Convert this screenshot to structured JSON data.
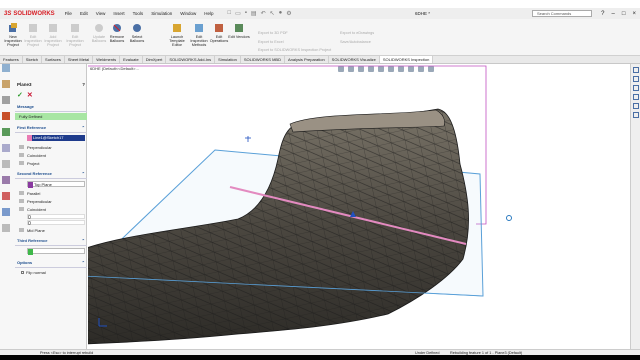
{
  "app": {
    "brand": "SOLIDWORKS",
    "doc_title": "6DHE *",
    "search_placeholder": "Search Commands"
  },
  "menu": [
    "File",
    "Edit",
    "View",
    "Insert",
    "Tools",
    "Simulation",
    "Window",
    "Help"
  ],
  "commands": [
    {
      "label": "New Inspection Project",
      "enabled": true
    },
    {
      "label": "Edit Inspection Project",
      "enabled": false
    },
    {
      "label": "Add Inspection Project",
      "enabled": false
    },
    {
      "label": "Edit Inspection Project",
      "enabled": false
    },
    {
      "label": "Update Balloons",
      "enabled": false
    },
    {
      "label": "Remove Balloons",
      "enabled": true
    },
    {
      "label": "Select Balloons",
      "enabled": true
    },
    {
      "label": "Launch Template Editor",
      "enabled": true
    },
    {
      "label": "Edit Inspection Methods",
      "enabled": true
    },
    {
      "label": "Edit Operations",
      "enabled": true
    },
    {
      "label": "Edit Vendors",
      "enabled": true
    }
  ],
  "small_commands": [
    "Export to 3D PDF",
    "Export to Excel",
    "Export to SOLIDWORKS Inspection Project",
    "Export to eDrawings",
    "Save/Autobalance"
  ],
  "tabs": [
    "Features",
    "Sketch",
    "Surfaces",
    "Sheet Metal",
    "Weldments",
    "Evaluate",
    "DimXpert",
    "SOLIDWORKS Add-Ins",
    "Simulation",
    "SOLIDWORKS MBD",
    "Analysis Preparation",
    "SOLIDWORKS Visualize",
    "SOLIDWORKS Inspection"
  ],
  "active_tab": "SOLIDWORKS Inspection",
  "feature_tree_path": "6DHE (Default<<Default>...",
  "property_manager": {
    "title": "Plane3",
    "message_label": "Message",
    "message_text": "Fully Defined",
    "first_reference": {
      "header": "First Reference",
      "value": "Line1@Sketch17",
      "options": [
        "Perpendicular",
        "Coincident",
        "Project"
      ]
    },
    "second_reference": {
      "header": "Second Reference",
      "value": "Top Plane",
      "options": [
        "Parallel",
        "Perpendicular",
        "Coincident"
      ],
      "spin1": "0",
      "spin2": "0",
      "extra_option": "Mid Plane"
    },
    "third_reference": {
      "header": "Third Reference",
      "value": ""
    },
    "options_section": {
      "header": "Options",
      "flip_normal": "Flip normal"
    }
  },
  "status": {
    "left": "Press <Esc> to interrupt rebuild",
    "mid1": "Under Defined",
    "mid2": "Rebuilding feature 1 of 1 - Plane3 (Default)",
    "right": ""
  },
  "colors": {
    "accent_red": "#d81f26",
    "ok_green": "#2a9a2a",
    "plane_blue": "#5aa0d8",
    "axis_pink": "#e38ac0",
    "shoe_dark": "#3d3a35"
  }
}
